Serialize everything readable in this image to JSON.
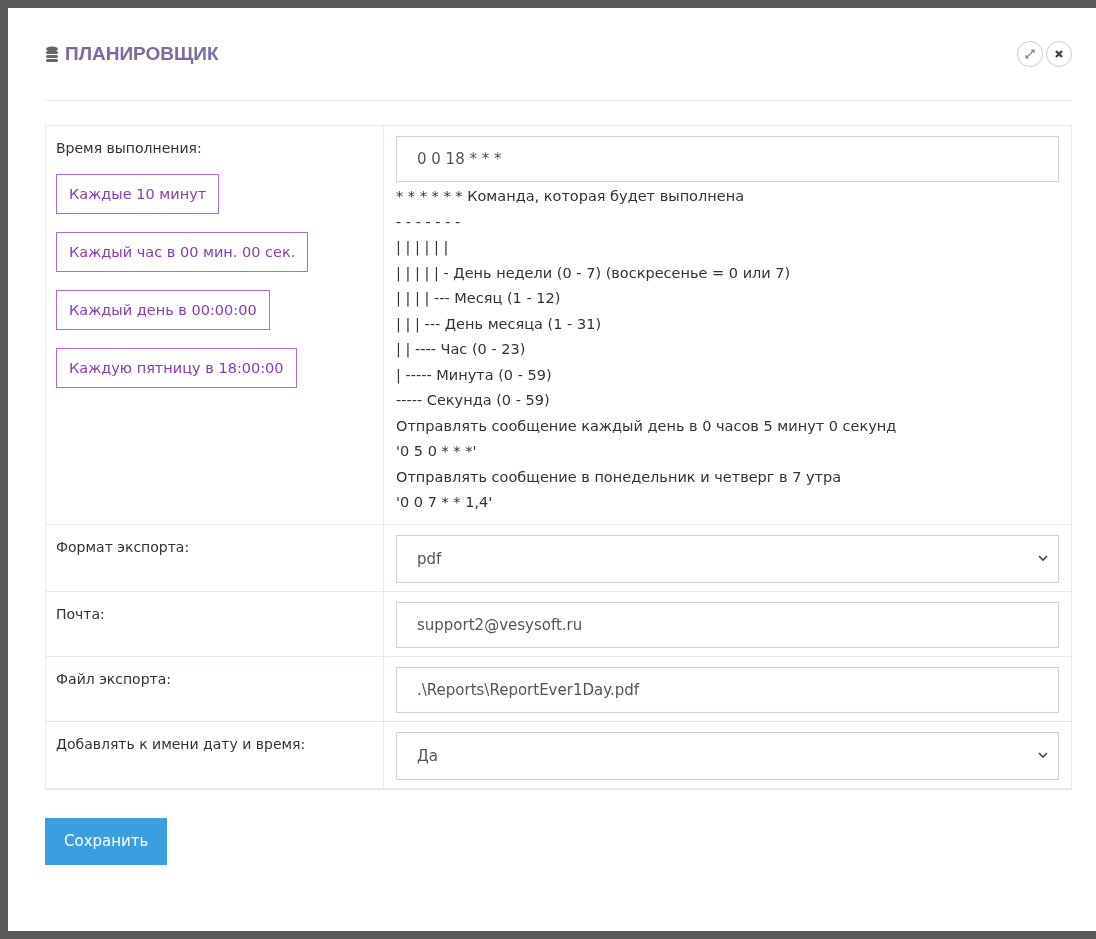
{
  "dialog": {
    "title": "ПЛАНИРОВЩИК"
  },
  "schedule": {
    "label": "Время выполнения:",
    "presets": [
      "Каждые 10 минут",
      "Каждый час в 00 мин. 00 сек.",
      "Каждый день в 00:00:00",
      "Каждую пятницу в 18:00:00"
    ],
    "value": "0 0 18 * * *",
    "help_lines": [
      "* * * * * * Команда, которая будет выполнена",
      "- - - - - - -",
      "| | | | | |",
      "| | | | | - День недели (0 - 7) (воскресенье = 0 или 7)",
      "| | | | --- Месяц (1 - 12)",
      "| | | --- День месяца (1 - 31)",
      "| | ---- Час (0 - 23)",
      "| ----- Минута (0 - 59)",
      "----- Секунда (0 - 59)",
      "Отправлять сообщение каждый день в 0 часов 5 минут 0 секунд",
      "'0 5 0 * * *'",
      "Отправлять сообщение в понедельник и четверг в 7 утра",
      "'0 0 7 * * 1,4'"
    ]
  },
  "fields": [
    {
      "label": "Формат экспорта:",
      "kind": "select",
      "value": "pdf"
    },
    {
      "label": "Почта:",
      "kind": "text",
      "value": "support2@vesysoft.ru"
    },
    {
      "label": "Файл экспорта:",
      "kind": "text",
      "value": ".\\Reports\\ReportEver1Day.pdf"
    },
    {
      "label": "Добавлять к имени дату и время:",
      "kind": "select",
      "value": "Да"
    }
  ],
  "save_button": "Сохранить"
}
